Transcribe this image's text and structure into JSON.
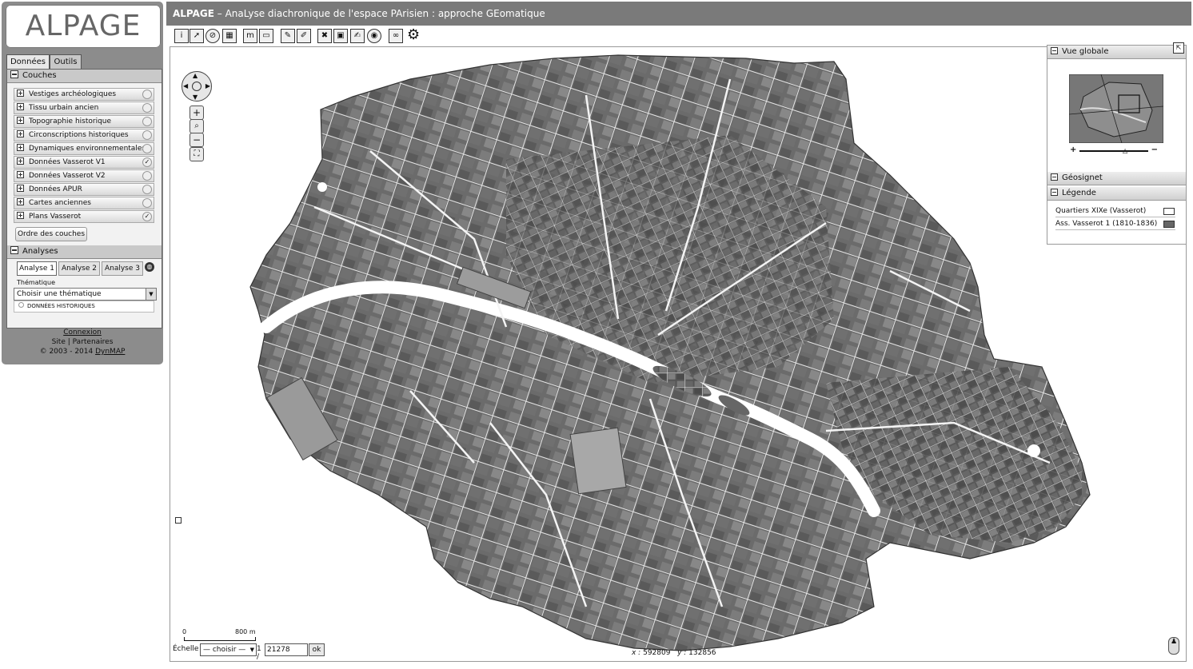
{
  "logo": {
    "text": "ALPAGE"
  },
  "tabs": [
    {
      "label": "Données"
    },
    {
      "label": "Outils"
    }
  ],
  "couches": {
    "header": "Couches",
    "layers": [
      {
        "label": "Vestiges archéologiques",
        "checked": false
      },
      {
        "label": "Tissu urbain ancien",
        "checked": false
      },
      {
        "label": "Topographie historique",
        "checked": false
      },
      {
        "label": "Circonscriptions historiques",
        "checked": false
      },
      {
        "label": "Dynamiques environnementales",
        "checked": false
      },
      {
        "label": "Données Vasserot V1",
        "checked": true
      },
      {
        "label": "Données Vasserot V2",
        "checked": false
      },
      {
        "label": "Données APUR",
        "checked": false
      },
      {
        "label": "Cartes anciennes",
        "checked": false
      },
      {
        "label": "Plans Vasserot",
        "checked": true
      }
    ],
    "order_button": "Ordre des couches"
  },
  "analyses": {
    "header": "Analyses",
    "tabs": [
      {
        "label": "Analyse 1"
      },
      {
        "label": "Analyse 2"
      },
      {
        "label": "Analyse 3"
      }
    ],
    "thematic_label": "Thématique",
    "thematic_select": "Choisir une thématique",
    "historic_data": "DONNÉES HISTORIQUES"
  },
  "footer": {
    "connexion": "Connexion",
    "site": "Site",
    "separator": "|",
    "partenaires": "Partenaires",
    "copyright": "© 2003 - 2014",
    "brand": "DynMAP"
  },
  "title": {
    "name": "ALPAGE",
    "subtitle": " – AnaLyse diachronique de l'espace PArisien : approche GEomatique"
  },
  "toolbar": {
    "icons": [
      "info-icon",
      "select-arrow-icon",
      "no-entry-icon",
      "table-icon",
      "ruler-icon",
      "area-measure-icon",
      "draw-line-icon",
      "draw-point-icon",
      "delete-feature-icon",
      "image-icon",
      "edit-icon",
      "marker-icon",
      "link-icon",
      "gear-icon"
    ]
  },
  "right_panel": {
    "vue_globale": "Vue globale",
    "geosignet": "Géosignet",
    "legende": "Légende",
    "legend_items": [
      {
        "label": "Quartiers XIXe (Vasserot)",
        "color": "#ffffff"
      },
      {
        "label": "Ass. Vasserot 1 (1810-1836)",
        "color": "#666666"
      }
    ]
  },
  "scale": {
    "zero": "0",
    "distance": "800 m",
    "echelle_label": "Échelle",
    "select_value": "— choisir —",
    "ratio_prefix": "1 /",
    "ratio_value": "21278",
    "ok": "ok"
  },
  "coords": {
    "x_label": "x :",
    "x": "592809",
    "y_label": "y :",
    "y": "132856"
  }
}
